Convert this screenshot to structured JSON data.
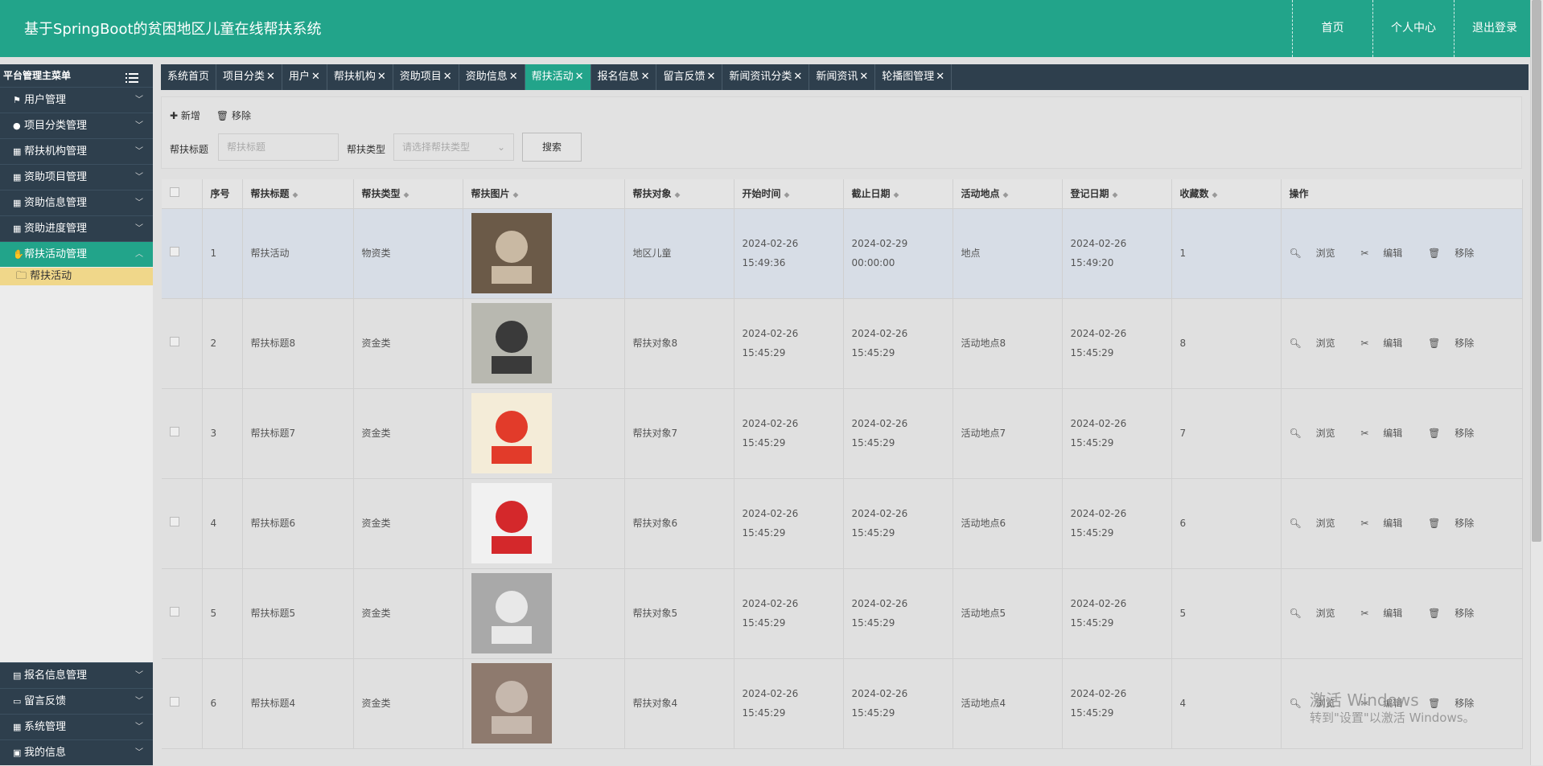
{
  "app": {
    "title": "基于SpringBoot的贫困地区儿童在线帮扶系统",
    "nav": [
      "首页",
      "个人中心",
      "退出登录"
    ]
  },
  "sidebar": {
    "header": "平台管理主菜单",
    "items": [
      {
        "label": "用户管理",
        "icon": "flag-icon"
      },
      {
        "label": "项目分类管理",
        "icon": "pin-icon"
      },
      {
        "label": "帮扶机构管理",
        "icon": "grid-icon"
      },
      {
        "label": "资助项目管理",
        "icon": "grid-icon"
      },
      {
        "label": "资助信息管理",
        "icon": "grid-icon"
      },
      {
        "label": "资助进度管理",
        "icon": "grid-icon"
      },
      {
        "label": "帮扶活动管理",
        "icon": "thumbs-up-icon"
      }
    ],
    "active_sub": "帮扶活动",
    "bottom_items": [
      {
        "label": "报名信息管理",
        "icon": "clipboard-icon"
      },
      {
        "label": "留言反馈",
        "icon": "message-icon"
      },
      {
        "label": "系统管理",
        "icon": "grid-icon"
      },
      {
        "label": "我的信息",
        "icon": "card-icon"
      }
    ]
  },
  "tabs": [
    "系统首页",
    "项目分类",
    "用户",
    "帮扶机构",
    "资助项目",
    "资助信息",
    "帮扶活动",
    "报名信息",
    "留言反馈",
    "新闻资讯分类",
    "新闻资讯",
    "轮播图管理"
  ],
  "active_tab": "帮扶活动",
  "toolbar": {
    "add": "新增",
    "remove": "移除"
  },
  "filter": {
    "title_label": "帮扶标题",
    "title_placeholder": "帮扶标题",
    "type_label": "帮扶类型",
    "type_placeholder": "请选择帮扶类型",
    "search": "搜索"
  },
  "table": {
    "columns": [
      "序号",
      "帮扶标题",
      "帮扶类型",
      "帮扶图片",
      "帮扶对象",
      "开始时间",
      "截止日期",
      "活动地点",
      "登记日期",
      "收藏数",
      "操作"
    ],
    "ops": [
      "浏览",
      "编辑",
      "移除"
    ],
    "rows": [
      {
        "no": "1",
        "title": "帮扶活动",
        "type": "物资类",
        "target": "地区儿童",
        "start": "2024-02-26 15:49:36",
        "end": "2024-02-29 00:00:00",
        "place": "地点",
        "reg": "2024-02-26 15:49:20",
        "fav": "1"
      },
      {
        "no": "2",
        "title": "帮扶标题8",
        "type": "资金类",
        "target": "帮扶对象8",
        "start": "2024-02-26 15:45:29",
        "end": "2024-02-26 15:45:29",
        "place": "活动地点8",
        "reg": "2024-02-26 15:45:29",
        "fav": "8"
      },
      {
        "no": "3",
        "title": "帮扶标题7",
        "type": "资金类",
        "target": "帮扶对象7",
        "start": "2024-02-26 15:45:29",
        "end": "2024-02-26 15:45:29",
        "place": "活动地点7",
        "reg": "2024-02-26 15:45:29",
        "fav": "7"
      },
      {
        "no": "4",
        "title": "帮扶标题6",
        "type": "资金类",
        "target": "帮扶对象6",
        "start": "2024-02-26 15:45:29",
        "end": "2024-02-26 15:45:29",
        "place": "活动地点6",
        "reg": "2024-02-26 15:45:29",
        "fav": "6"
      },
      {
        "no": "5",
        "title": "帮扶标题5",
        "type": "资金类",
        "target": "帮扶对象5",
        "start": "2024-02-26 15:45:29",
        "end": "2024-02-26 15:45:29",
        "place": "活动地点5",
        "reg": "2024-02-26 15:45:29",
        "fav": "5"
      },
      {
        "no": "6",
        "title": "帮扶标题4",
        "type": "资金类",
        "target": "帮扶对象4",
        "start": "2024-02-26 15:45:29",
        "end": "2024-02-26 15:45:29",
        "place": "活动地点4",
        "reg": "2024-02-26 15:45:29",
        "fav": "4"
      }
    ]
  },
  "watermark": {
    "line1": "激活 Windows",
    "line2": "转到\"设置\"以激活 Windows。"
  }
}
